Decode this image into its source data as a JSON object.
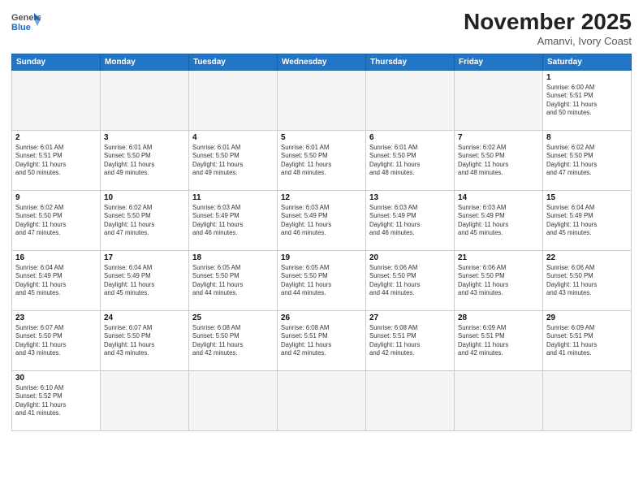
{
  "header": {
    "title": "November 2025",
    "subtitle": "Amanvi, Ivory Coast",
    "logo_general": "General",
    "logo_blue": "Blue"
  },
  "days_of_week": [
    "Sunday",
    "Monday",
    "Tuesday",
    "Wednesday",
    "Thursday",
    "Friday",
    "Saturday"
  ],
  "weeks": [
    [
      {
        "day": "",
        "info": ""
      },
      {
        "day": "",
        "info": ""
      },
      {
        "day": "",
        "info": ""
      },
      {
        "day": "",
        "info": ""
      },
      {
        "day": "",
        "info": ""
      },
      {
        "day": "",
        "info": ""
      },
      {
        "day": "1",
        "info": "Sunrise: 6:00 AM\nSunset: 5:51 PM\nDaylight: 11 hours\nand 50 minutes."
      }
    ],
    [
      {
        "day": "2",
        "info": "Sunrise: 6:01 AM\nSunset: 5:51 PM\nDaylight: 11 hours\nand 50 minutes."
      },
      {
        "day": "3",
        "info": "Sunrise: 6:01 AM\nSunset: 5:50 PM\nDaylight: 11 hours\nand 49 minutes."
      },
      {
        "day": "4",
        "info": "Sunrise: 6:01 AM\nSunset: 5:50 PM\nDaylight: 11 hours\nand 49 minutes."
      },
      {
        "day": "5",
        "info": "Sunrise: 6:01 AM\nSunset: 5:50 PM\nDaylight: 11 hours\nand 48 minutes."
      },
      {
        "day": "6",
        "info": "Sunrise: 6:01 AM\nSunset: 5:50 PM\nDaylight: 11 hours\nand 48 minutes."
      },
      {
        "day": "7",
        "info": "Sunrise: 6:02 AM\nSunset: 5:50 PM\nDaylight: 11 hours\nand 48 minutes."
      },
      {
        "day": "8",
        "info": "Sunrise: 6:02 AM\nSunset: 5:50 PM\nDaylight: 11 hours\nand 47 minutes."
      }
    ],
    [
      {
        "day": "9",
        "info": "Sunrise: 6:02 AM\nSunset: 5:50 PM\nDaylight: 11 hours\nand 47 minutes."
      },
      {
        "day": "10",
        "info": "Sunrise: 6:02 AM\nSunset: 5:50 PM\nDaylight: 11 hours\nand 47 minutes."
      },
      {
        "day": "11",
        "info": "Sunrise: 6:03 AM\nSunset: 5:49 PM\nDaylight: 11 hours\nand 46 minutes."
      },
      {
        "day": "12",
        "info": "Sunrise: 6:03 AM\nSunset: 5:49 PM\nDaylight: 11 hours\nand 46 minutes."
      },
      {
        "day": "13",
        "info": "Sunrise: 6:03 AM\nSunset: 5:49 PM\nDaylight: 11 hours\nand 46 minutes."
      },
      {
        "day": "14",
        "info": "Sunrise: 6:03 AM\nSunset: 5:49 PM\nDaylight: 11 hours\nand 45 minutes."
      },
      {
        "day": "15",
        "info": "Sunrise: 6:04 AM\nSunset: 5:49 PM\nDaylight: 11 hours\nand 45 minutes."
      }
    ],
    [
      {
        "day": "16",
        "info": "Sunrise: 6:04 AM\nSunset: 5:49 PM\nDaylight: 11 hours\nand 45 minutes."
      },
      {
        "day": "17",
        "info": "Sunrise: 6:04 AM\nSunset: 5:49 PM\nDaylight: 11 hours\nand 45 minutes."
      },
      {
        "day": "18",
        "info": "Sunrise: 6:05 AM\nSunset: 5:50 PM\nDaylight: 11 hours\nand 44 minutes."
      },
      {
        "day": "19",
        "info": "Sunrise: 6:05 AM\nSunset: 5:50 PM\nDaylight: 11 hours\nand 44 minutes."
      },
      {
        "day": "20",
        "info": "Sunrise: 6:06 AM\nSunset: 5:50 PM\nDaylight: 11 hours\nand 44 minutes."
      },
      {
        "day": "21",
        "info": "Sunrise: 6:06 AM\nSunset: 5:50 PM\nDaylight: 11 hours\nand 43 minutes."
      },
      {
        "day": "22",
        "info": "Sunrise: 6:06 AM\nSunset: 5:50 PM\nDaylight: 11 hours\nand 43 minutes."
      }
    ],
    [
      {
        "day": "23",
        "info": "Sunrise: 6:07 AM\nSunset: 5:50 PM\nDaylight: 11 hours\nand 43 minutes."
      },
      {
        "day": "24",
        "info": "Sunrise: 6:07 AM\nSunset: 5:50 PM\nDaylight: 11 hours\nand 43 minutes."
      },
      {
        "day": "25",
        "info": "Sunrise: 6:08 AM\nSunset: 5:50 PM\nDaylight: 11 hours\nand 42 minutes."
      },
      {
        "day": "26",
        "info": "Sunrise: 6:08 AM\nSunset: 5:51 PM\nDaylight: 11 hours\nand 42 minutes."
      },
      {
        "day": "27",
        "info": "Sunrise: 6:08 AM\nSunset: 5:51 PM\nDaylight: 11 hours\nand 42 minutes."
      },
      {
        "day": "28",
        "info": "Sunrise: 6:09 AM\nSunset: 5:51 PM\nDaylight: 11 hours\nand 42 minutes."
      },
      {
        "day": "29",
        "info": "Sunrise: 6:09 AM\nSunset: 5:51 PM\nDaylight: 11 hours\nand 41 minutes."
      }
    ],
    [
      {
        "day": "30",
        "info": "Sunrise: 6:10 AM\nSunset: 5:52 PM\nDaylight: 11 hours\nand 41 minutes."
      },
      {
        "day": "",
        "info": ""
      },
      {
        "day": "",
        "info": ""
      },
      {
        "day": "",
        "info": ""
      },
      {
        "day": "",
        "info": ""
      },
      {
        "day": "",
        "info": ""
      },
      {
        "day": "",
        "info": ""
      }
    ]
  ]
}
